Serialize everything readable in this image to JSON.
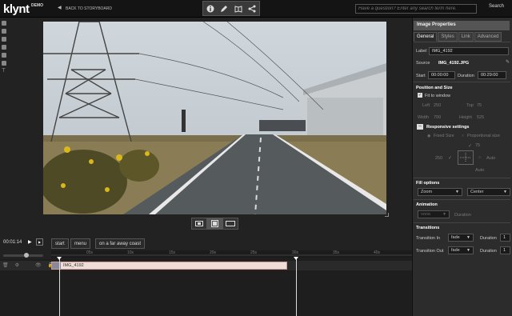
{
  "app": {
    "logo": "klynt",
    "logo_badge": "DEMO",
    "back_label": "BACK TO STORYBOARD"
  },
  "toolbar": {
    "icons": [
      "info-icon",
      "pencil-icon",
      "book-icon",
      "share-icon"
    ]
  },
  "search": {
    "placeholder": "Have a question? Enter any search term here.",
    "button": "Search"
  },
  "panel": {
    "title": "Image Properties",
    "tabs": [
      "General",
      "Styles",
      "Link",
      "Advanced"
    ],
    "label_label": "Label",
    "label_value": "IMG_4192",
    "source_label": "Source",
    "source_value": "IMG_4192.JPG",
    "start_label": "Start",
    "start_value": "00:00:00",
    "duration_label": "Duration",
    "duration_value": "00:29:00",
    "position_title": "Position and Size",
    "fit_label": "Fit to window",
    "left_label": "Left",
    "left_value": "250",
    "top_label": "Top",
    "top_value": "75",
    "width_label": "Width",
    "width_value": "700",
    "height_label": "Height",
    "height_value": "525",
    "responsive_title": "Responsive settings",
    "fixed_label": "Fixed Size",
    "proportional_label": "Proportional size",
    "prop_value": "75",
    "anchor_value": "250",
    "auto1": "Auto",
    "auto2": "Auto",
    "fill_title": "Fill options",
    "fill_mode": "Zoom",
    "fill_align": "Center",
    "animation_title": "Animation",
    "anim_value": "none",
    "anim_duration_label": "Duration",
    "transitions_title": "Transitions",
    "tin_label": "Transition In",
    "tin_value": "fade",
    "tin_dur_label": "Duration",
    "tin_dur_value": "1",
    "tout_label": "Transition Out",
    "tout_value": "fade",
    "tout_dur_label": "Duration",
    "tout_dur_value": "1"
  },
  "timeline": {
    "time": "00:01:14",
    "buttons": [
      "start",
      "menu"
    ],
    "title": "on a far away coast",
    "ticks": [
      "05s",
      "10s",
      "15s",
      "20s",
      "25s",
      "30s",
      "35s",
      "40s"
    ],
    "clip_label": "IMG_4192"
  }
}
